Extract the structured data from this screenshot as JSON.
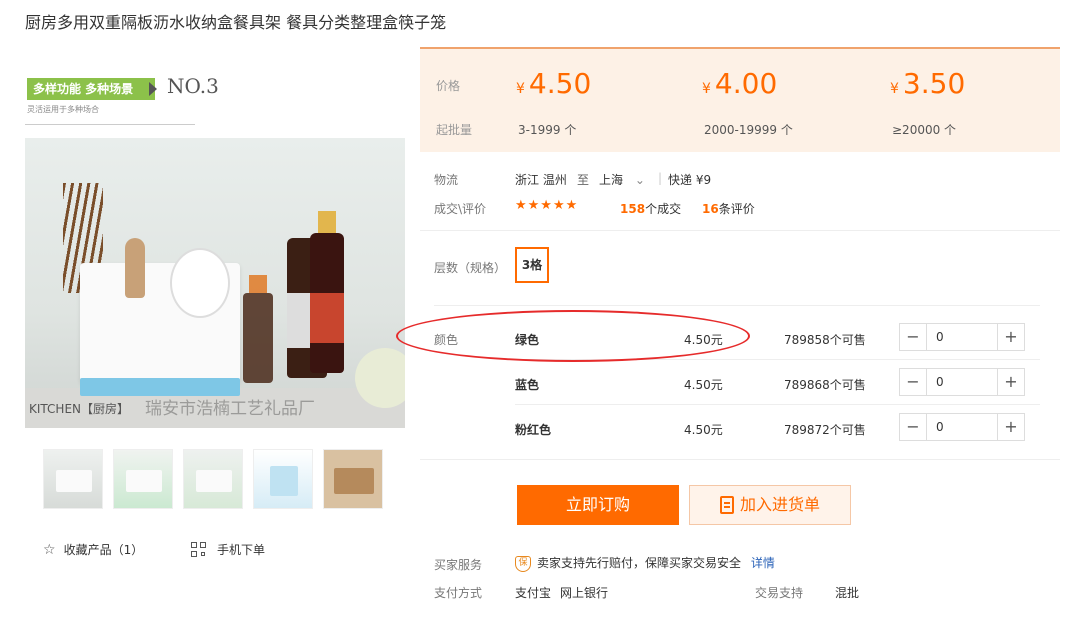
{
  "product": {
    "title": "厨房多用双重隔板沥水收纳盒餐具架 餐具分类整理盒筷子笼"
  },
  "gallery": {
    "banner_main": "多样功能 多种场景",
    "banner_no": "NO.3",
    "banner_sub": "灵活运用于多种场合",
    "watermark_left": "KITCHEN【厨房】",
    "watermark_shop": "瑞安市浩楠工艺礼品厂",
    "favorite_label": "收藏产品（1）",
    "mobile_label": "手机下单"
  },
  "pricing": {
    "price_label": "价格",
    "moq_label": "起批量",
    "currency": "¥",
    "tiers": [
      {
        "price": "4.50",
        "range": "3-1999 个"
      },
      {
        "price": "4.00",
        "range": "2000-19999 个"
      },
      {
        "price": "3.50",
        "range": "≥20000 个"
      }
    ]
  },
  "logistics": {
    "label": "物流",
    "from": "浙江 温州",
    "to_word": "至",
    "to": "上海",
    "shipping": "快递 ¥9"
  },
  "reviews": {
    "label": "成交\\评价",
    "stars": "★★★★★",
    "deals_count": "158",
    "deals_suffix": "个成交",
    "review_count": "16",
    "review_suffix": "条评价"
  },
  "spec": {
    "label": "层数（规格）",
    "selected": "3格"
  },
  "colors": {
    "label": "颜色",
    "rows": [
      {
        "name": "绿色",
        "price": "4.50元",
        "stock": "789858个可售",
        "qty": "0"
      },
      {
        "name": "蓝色",
        "price": "4.50元",
        "stock": "789868个可售",
        "qty": "0"
      },
      {
        "name": "粉红色",
        "price": "4.50元",
        "stock": "789872个可售",
        "qty": "0"
      }
    ]
  },
  "actions": {
    "buy_now": "立即订购",
    "add_to_list": "加入进货单"
  },
  "service": {
    "buyer_label": "买家服务",
    "guarantee_icon": "保",
    "guarantee_text": "卖家支持先行赔付，保障买家交易安全",
    "details_link": "详情",
    "payment_label": "支付方式",
    "pay_alipay": "支付宝",
    "pay_bank": "网上银行",
    "trade_label": "交易支持",
    "trade_value": "混批"
  },
  "colors_theme": {
    "accent": "#ff6a00",
    "price_bg": "#fdf1e6",
    "annotation": "#e62b2b"
  }
}
